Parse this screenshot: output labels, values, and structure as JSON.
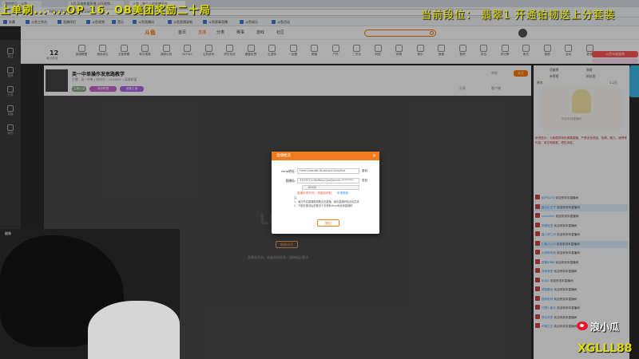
{
  "browser": {
    "tabs": [
      {
        "label": "我的首页 - 斗鱼"
      },
      {
        "label": "LOL英雄联盟直播_LOL视频..."
      },
      {
        "label": "斗鱼 - 每个人的直播平台"
      }
    ],
    "url": "https://www.douyu.com/...",
    "bookmarks": [
      "收藏",
      "斗鱼工作台",
      "直播伴侣",
      "斗鱼视频",
      "音乐",
      "斗鱼直播间",
      "斗鱼直播录制",
      "斗鱼赛事直播",
      "斗鱼娱乐",
      "斗鱼活动"
    ]
  },
  "header": {
    "logo": "斗鱼",
    "nav": [
      "首页",
      "直播",
      "分类",
      "赛事",
      "游戏",
      "社区"
    ],
    "active_nav": "直播"
  },
  "categories": {
    "date_num": "12",
    "date_sub": "每日签到",
    "items": [
      "英雄联盟",
      "绝地求生",
      "王者荣耀",
      "和平精英",
      "穿越火线",
      "DOTA2",
      "主机游戏",
      "炉石传说",
      "魔兽世界",
      "云游戏",
      "一起看",
      "颜值",
      "户外",
      "二次元",
      "科技",
      "体育",
      "音乐",
      "美食",
      "鱼吧",
      "综合",
      "排行榜",
      "鱼乐",
      "视频",
      "活动",
      "更多"
    ],
    "promo": "斗鱼年度盛典"
  },
  "leftrail": [
    "关注",
    "推荐",
    "分类",
    "直播",
    "我的"
  ],
  "room": {
    "title": "英一中单操作发思路教学",
    "meta": "主播：英一中单  |  房间号：1234567  |  英雄联盟",
    "tags": [
      "主播认证",
      "英雄联盟",
      "颜值主播"
    ],
    "follow": "关注",
    "right_stats": [
      "举报",
      "分享",
      "客户端"
    ]
  },
  "player": {
    "logo": "LIVE",
    "refresh": "刷新试试",
    "hint": "直播未开启，或者网络异常，请刷新后重试"
  },
  "modal": {
    "title": "直播推流",
    "server_label": "rtmp地址:",
    "server_value": "rtmp://sendtc3a.douyu.com/live",
    "copy1": "复制",
    "key_label": "直播码:",
    "key_value": "7953571rDWNtLc?wsSecret=********",
    "copy2": "复制",
    "select_label": "10000",
    "warn1": "直播码将失效，请重新获取",
    "warn2": "申请更新",
    "notes": [
      "注：",
      "1、每次开启直播都需要点击直播，每次直播码会自动生成",
      "2、只能在推流后前推流下去获取rtmp地址和直播码"
    ],
    "ok": "确定"
  },
  "rightpanel": {
    "tabs": [
      "贡献榜",
      "周榜",
      "亲密榜",
      "粉丝团",
      "贵宾",
      "1.2万"
    ],
    "banner_caption": "欢迎来到直播间",
    "notice": "系统提示：斗鱼倡导绿色健康直播，严禁涉及低俗、色情、暴力、赌博等内容，请文明观看，理性消费。",
    "chat": [
      {
        "user": "用户8273",
        "msg": "欢迎来到本直播间"
      },
      {
        "user": "鱼丸小王子",
        "msg": "欢迎来到本直播间"
      },
      {
        "user": "superfish",
        "msg": "欢迎来到本直播间"
      },
      {
        "user": "阿狸宝宝",
        "msg": "欢迎来到本直播间"
      },
      {
        "user": "路人甲乙丙",
        "msg": "欢迎来到本直播间"
      },
      {
        "user": "小鱼儿123",
        "msg": "欢迎来到本直播间"
      },
      {
        "user": "大神带带我",
        "msg": "欢迎来到本直播间"
      },
      {
        "user": "游客8888",
        "msg": "欢迎来到本直播间"
      },
      {
        "user": "深夜食堂",
        "msg": "欢迎来到本直播间"
      },
      {
        "user": "水友A",
        "msg": "欢迎来到本直播间"
      },
      {
        "user": "咸鱼翻身",
        "msg": "欢迎来到本直播间"
      },
      {
        "user": "猫咪老师",
        "msg": "欢迎来到本直播间"
      },
      {
        "user": "打野小能手",
        "msg": "欢迎来到本直播间"
      },
      {
        "user": "快乐风男",
        "msg": "欢迎来到本直播间"
      },
      {
        "user": "中单之王",
        "msg": "欢迎来到本直播间"
      }
    ]
  },
  "stream_overlay": {
    "ticker_left": "上单刷...  ...OP  16.  OB美团奖励二十局",
    "ticker_right": "当前段位：  翡翠1  开通铂韧送上分套装",
    "cam_label": "摄像",
    "weibo_name": "浪小瓜",
    "watermark": "XGLLL88"
  },
  "colors": {
    "accent": "#f07b1c",
    "ticker": "#dddd00",
    "weibo": "#e6162d"
  }
}
